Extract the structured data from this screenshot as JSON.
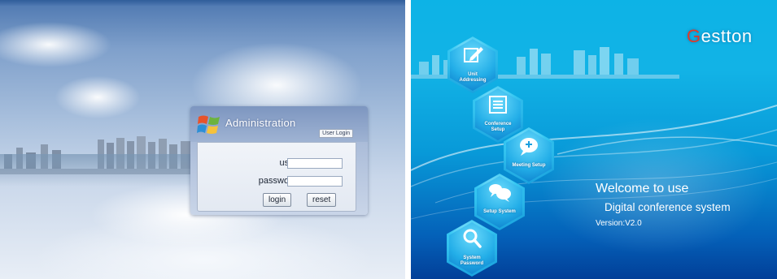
{
  "login": {
    "title": "Administration",
    "tab_label": "User Login",
    "user_label": "user :",
    "user_value": "",
    "password_label": "password :",
    "password_value": "",
    "login_button": "login",
    "reset_button": "reset"
  },
  "menu": {
    "brand": "Gestton",
    "items": [
      {
        "label": "Unit\nAddressing",
        "icon": "pencil-edit-icon"
      },
      {
        "label": "Conference\nSetup",
        "icon": "list-document-icon"
      },
      {
        "label": "Meeting Setup",
        "icon": "chat-plus-icon"
      },
      {
        "label": "Setup System",
        "icon": "chat-bubbles-icon"
      },
      {
        "label": "System\nPassword",
        "icon": "magnifier-icon"
      }
    ],
    "welcome": "Welcome to use",
    "subtitle": "Digital conference system",
    "version": "Version:V2.0"
  },
  "colors": {
    "left_sky_top": "#4d77b0",
    "right_bg_top": "#0db3e6",
    "right_bg_bottom": "#023f98",
    "brand_accent": "#e23a2a"
  }
}
